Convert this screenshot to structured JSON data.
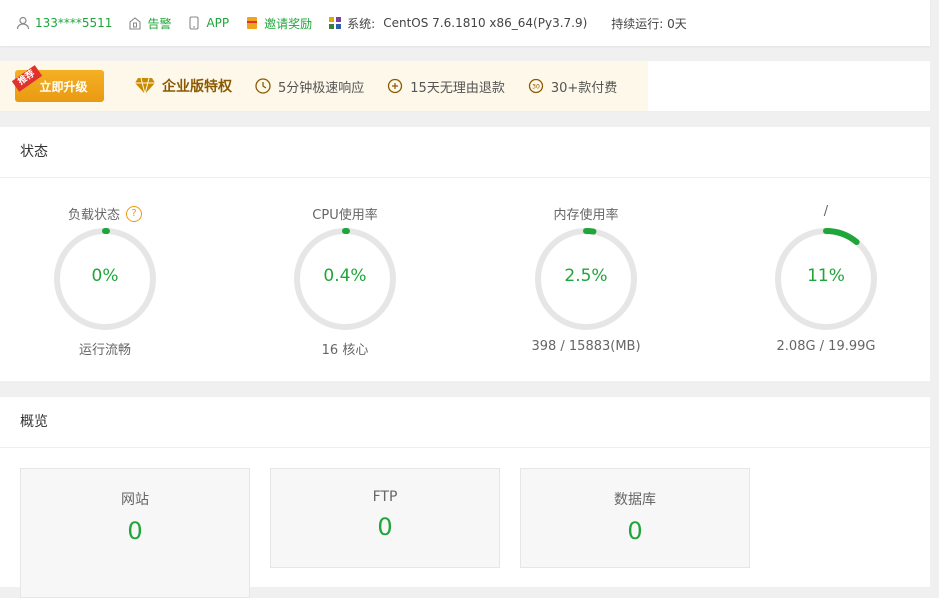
{
  "topbar": {
    "user": "133****5511",
    "alert": "告警",
    "app": "APP",
    "invite": "邀请奖励",
    "system_label": "系统:",
    "system_value": "CentOS 7.6.1810 x86_64(Py3.7.9)",
    "uptime": "持续运行: 0天"
  },
  "promo": {
    "badge": "推荐",
    "upgrade": "立即升级",
    "enterprise": "企业版特权",
    "feature1": "5分钟极速响应",
    "feature2": "15天无理由退款",
    "feature3": "30+款付费"
  },
  "status": {
    "title": "状态",
    "help_icon": "?",
    "gauges": [
      {
        "label": "负载状态",
        "value": "0%",
        "sub": "运行流畅",
        "percent": 0
      },
      {
        "label": "CPU使用率",
        "value": "0.4%",
        "sub": "16 核心",
        "percent": 0.4
      },
      {
        "label": "内存使用率",
        "value": "2.5%",
        "sub": "398 / 15883(MB)",
        "percent": 2.5
      },
      {
        "label": "/",
        "value": "11%",
        "sub": "2.08G / 19.99G",
        "percent": 11
      }
    ]
  },
  "overview": {
    "title": "概览",
    "cards": [
      {
        "name": "网站",
        "count": "0"
      },
      {
        "name": "FTP",
        "count": "0"
      },
      {
        "name": "数据库",
        "count": "0"
      }
    ]
  },
  "colors": {
    "accent": "#20a53a",
    "ring": "#e6e6e6",
    "promo_bg": "#fdf8ea",
    "upgrade": "#f0a41c"
  }
}
